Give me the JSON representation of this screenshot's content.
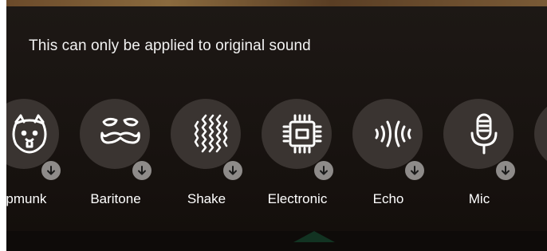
{
  "notice": {
    "text": "This can only be applied to original sound"
  },
  "effects": [
    {
      "label": "ipmunk",
      "icon": "chipmunk-icon"
    },
    {
      "label": "Baritone",
      "icon": "mustache-icon"
    },
    {
      "label": "Shake",
      "icon": "shake-icon"
    },
    {
      "label": "Electronic",
      "icon": "chip-icon"
    },
    {
      "label": "Echo",
      "icon": "echo-icon"
    },
    {
      "label": "Mic",
      "icon": "microphone-icon"
    },
    {
      "label": "",
      "icon": "more-effect-icon"
    }
  ],
  "download_icon": "download-arrow-icon",
  "colors": {
    "background": "#181310",
    "effect_circle": "#3a3431",
    "download_badge": "#8e8b89",
    "text": "#ffffff"
  }
}
